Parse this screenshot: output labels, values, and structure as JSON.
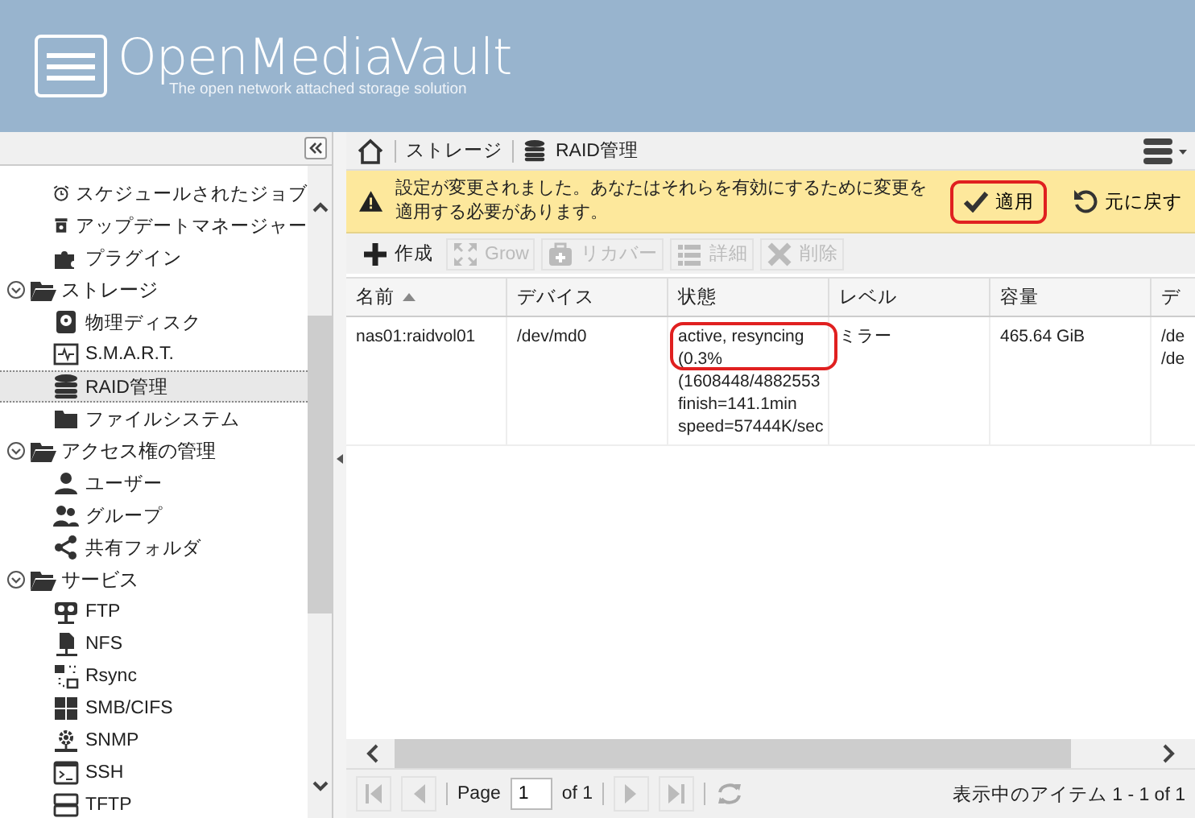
{
  "header": {
    "title": "OpenMediaVault",
    "subtitle": "The open network attached storage solution"
  },
  "sidebar": {
    "tree": [
      {
        "children": [
          {
            "label": "スケジュールされたジョブ",
            "selected": false
          },
          {
            "label": "アップデートマネージャー",
            "selected": false
          },
          {
            "label": "プラグイン",
            "selected": false
          }
        ]
      },
      {
        "label": "ストレージ",
        "expanded": true,
        "children": [
          {
            "label": "物理ディスク",
            "selected": false
          },
          {
            "label": "S.M.A.R.T.",
            "selected": false
          },
          {
            "label": "RAID管理",
            "selected": true
          },
          {
            "label": "ファイルシステム",
            "selected": false
          }
        ]
      },
      {
        "label": "アクセス権の管理",
        "expanded": true,
        "children": [
          {
            "label": "ユーザー",
            "selected": false
          },
          {
            "label": "グループ",
            "selected": false
          },
          {
            "label": "共有フォルダ",
            "selected": false
          }
        ]
      },
      {
        "label": "サービス",
        "expanded": true,
        "children": [
          {
            "label": "FTP",
            "selected": false
          },
          {
            "label": "NFS",
            "selected": false
          },
          {
            "label": "Rsync",
            "selected": false
          },
          {
            "label": "SMB/CIFS",
            "selected": false
          },
          {
            "label": "SNMP",
            "selected": false
          },
          {
            "label": "SSH",
            "selected": false
          },
          {
            "label": "TFTP",
            "selected": false
          }
        ]
      }
    ]
  },
  "breadcrumb": [
    "ストレージ",
    "RAID管理"
  ],
  "notice": {
    "message": "設定が変更されました。あなたはそれらを有効にするために変更を適用する必要があります。",
    "apply": {
      "label": "適用",
      "highlighted": true
    },
    "revert": "元に戻す"
  },
  "toolbar": [
    {
      "label": "作成",
      "disabled": false
    },
    {
      "label": "Grow",
      "disabled": true
    },
    {
      "label": "リカバー",
      "disabled": true
    },
    {
      "label": "詳細",
      "disabled": true
    },
    {
      "label": "削除",
      "disabled": true
    }
  ],
  "table": {
    "columns": [
      {
        "label": "名前",
        "sorted": true
      },
      {
        "label": "デバイス",
        "sorted": false
      },
      {
        "label": "状態",
        "sorted": false
      },
      {
        "label": "レベル",
        "sorted": false
      },
      {
        "label": "容量",
        "sorted": false
      },
      {
        "label": "デ",
        "sorted": false
      }
    ],
    "rows": [
      {
        "cells": [
          {
            "lines": [
              "nas01:raidvol01"
            ],
            "highlighted": false
          },
          {
            "lines": [
              "/dev/md0"
            ],
            "highlighted": false
          },
          {
            "lines": [
              "active, resyncing",
              "(0.3%",
              "(1608448/4882553",
              "finish=141.1min",
              "speed=57444K/sec"
            ],
            "highlighted": true
          },
          {
            "lines": [
              "ミラー"
            ],
            "highlighted": false
          },
          {
            "lines": [
              "465.64 GiB"
            ],
            "highlighted": false
          },
          {
            "lines": [
              "/de",
              "/de"
            ],
            "highlighted": false
          }
        ]
      }
    ]
  },
  "pager": {
    "page_label": "Page",
    "page": "1",
    "of": "of 1",
    "summary": "表示中のアイテム 1 - 1 of 1"
  }
}
